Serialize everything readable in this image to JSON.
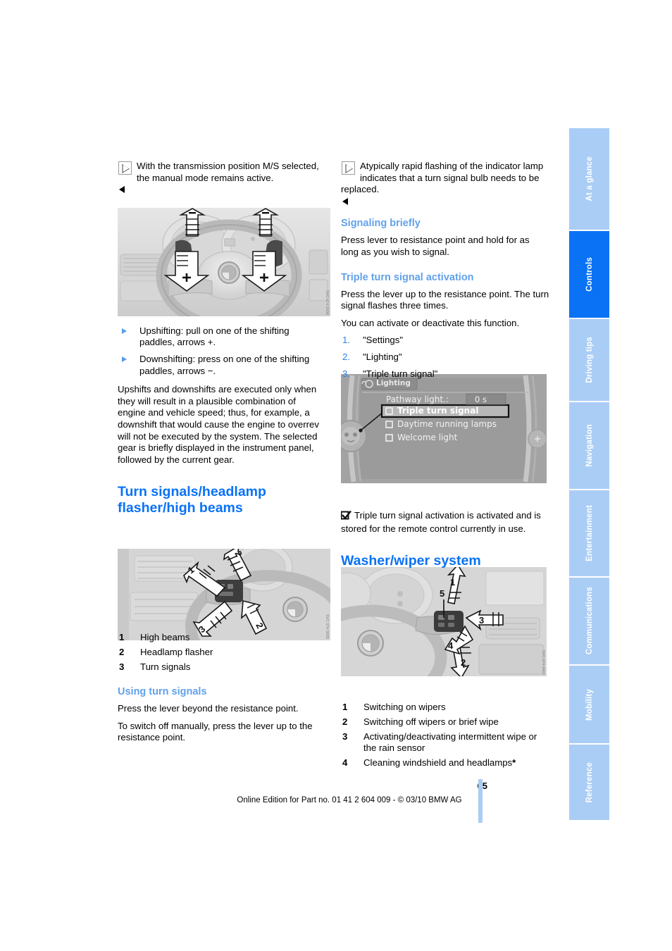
{
  "document": {
    "page_number": "65",
    "footer_text": "Online Edition for Part no. 01 41 2 604 009 - © 03/10 BMW AG"
  },
  "tabs": [
    {
      "label": "At a glance",
      "active": false
    },
    {
      "label": "Controls",
      "active": true
    },
    {
      "label": "Driving tips",
      "active": false
    },
    {
      "label": "Navigation",
      "active": false
    },
    {
      "label": "Entertainment",
      "active": false
    },
    {
      "label": "Communications",
      "active": false
    },
    {
      "label": "Mobility",
      "active": false
    },
    {
      "label": "Reference",
      "active": false
    }
  ],
  "colors": {
    "heading_blue": "#0a72f5",
    "subheading_blue": "#62a1ea",
    "tab_inactive": "#aacdf5",
    "tab_active": "#0a72f5",
    "figure_bg": "#d9d9d9"
  },
  "left_column": {
    "note_transmission": "With the transmission position M/S selected, the manual mode remains active.",
    "figure_steering_wheel": {
      "name": "steering-wheel-shift-paddles",
      "watermark": "SVC 074 0006"
    },
    "bullets": [
      "Upshifting: pull on one of the shifting paddles, arrows +.",
      "Downshifting: press on one of the shifting paddles, arrows −."
    ],
    "paragraph_shifts": "Upshifts and downshifts are executed only when they will result in a plausible combination of engine and vehicle speed; thus, for example, a downshift that would cause the engine to overrev will not be executed by the system. The selected gear is briefly displayed in the instrument panel, followed by the current gear.",
    "section_heading": "Turn signals/headlamp flasher/high beams",
    "figure_turn_signal_lever": {
      "name": "turn-signal-headlamp-lever",
      "watermark": "SVC 074 0005"
    },
    "legend": [
      {
        "n": "1",
        "label": "High beams"
      },
      {
        "n": "2",
        "label": "Headlamp flasher"
      },
      {
        "n": "3",
        "label": "Turn signals"
      }
    ],
    "subheading_using": "Using turn signals",
    "using_paragraphs": [
      "Press the lever beyond the resistance point.",
      "To switch off manually, press the lever up to the resistance point."
    ]
  },
  "right_column": {
    "note_bulb": "Atypically rapid flashing of the indicator lamp indicates that a turn signal bulb needs to be replaced.",
    "subheading_signaling": "Signaling briefly",
    "signaling_text": "Press lever to resistance point and hold for as long as you wish to signal.",
    "subheading_triple": "Triple turn signal activation",
    "triple_text_1": "Press the lever up to the resistance point. The turn signal flashes three times.",
    "triple_text_2": "You can activate or deactivate this function.",
    "steps": [
      {
        "n": "1.",
        "label": "\"Settings\""
      },
      {
        "n": "2.",
        "label": "\"Lighting\""
      },
      {
        "n": "3.",
        "label": "\"Triple turn signal\""
      }
    ],
    "idrive_screen": {
      "name": "idrive-lighting-menu",
      "title": "Lighting",
      "rows": [
        {
          "label": "Pathway light.:",
          "value": "0 s",
          "checkbox": false,
          "highlighted": false
        },
        {
          "label": "Triple turn signal",
          "value": "",
          "checkbox": true,
          "highlighted": true
        },
        {
          "label": "Daytime running lamps",
          "value": "",
          "checkbox": true,
          "highlighted": false
        },
        {
          "label": "Welcome light",
          "value": "",
          "checkbox": true,
          "highlighted": false
        }
      ]
    },
    "check_note": "Triple turn signal activation is activated and is stored for the remote control currently in use.",
    "section_heading": "Washer/wiper system",
    "figure_wiper_lever": {
      "name": "washer-wiper-lever",
      "watermark": "SVC 074 0003"
    },
    "legend": [
      {
        "n": "1",
        "label": "Switching on wipers"
      },
      {
        "n": "2",
        "label": "Switching off wipers or brief wipe"
      },
      {
        "n": "3",
        "label": "Activating/deactivating intermittent wipe or the rain sensor"
      },
      {
        "n": "4",
        "label": "Cleaning windshield and headlamps"
      }
    ],
    "legend_4_star": "*"
  }
}
